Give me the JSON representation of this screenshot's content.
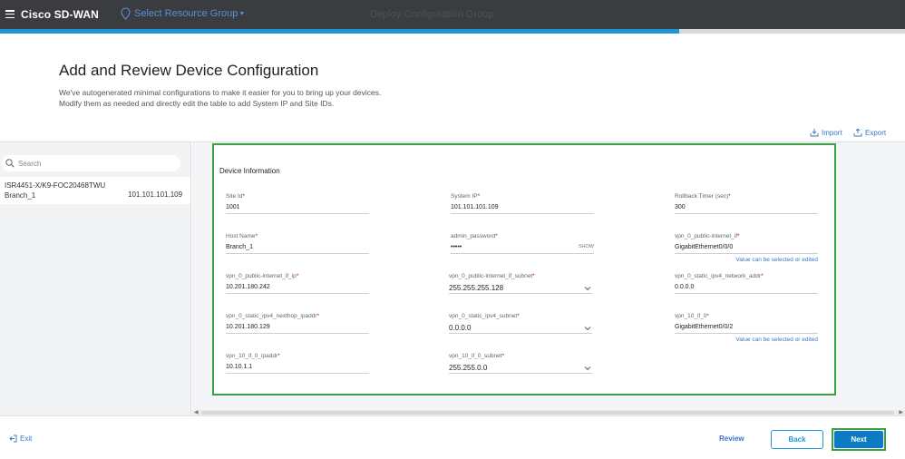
{
  "topbar": {
    "brand": "Cisco SD-WAN",
    "resource_group": "Select Resource Group",
    "center_title": "Deploy Configuration Group",
    "progress_percent": 75
  },
  "page": {
    "title": "Add and Review Device Configuration",
    "description_line1": "We've autogenerated minimal configurations to make it easier for you to bring up your devices.",
    "description_line2": "Modify them as needed and directly edit the table to add System IP and Site IDs.",
    "import_label": "Import",
    "export_label": "Export"
  },
  "sidebar": {
    "search_placeholder": "Search",
    "devices": [
      {
        "name": "ISR4451-X/K9-FOC20468TWU",
        "site": "Branch_1",
        "ip": "101.101.101.109"
      }
    ]
  },
  "form": {
    "section_title": "Device Information",
    "fields": [
      {
        "label": "Site Id",
        "required": "*",
        "value": "1001"
      },
      {
        "label": "System IP",
        "required": "*",
        "value": "101.101.101.109"
      },
      {
        "label": "Rollback Timer (sec)",
        "required": "*",
        "value": "300"
      },
      {
        "label": "Host Name",
        "required": "*",
        "value": "Branch_1"
      },
      {
        "label": "admin_password",
        "required": "*",
        "value": "•••••",
        "show": "SHOW"
      },
      {
        "label": "vpn_0_public-internet_if",
        "required": "*",
        "value": "GigabitEthernet0/0/0",
        "hint": "Value can be selected or edited"
      },
      {
        "label": "vpn_0_public-internet_if_ip",
        "required": "*",
        "value": "10.201.180.242"
      },
      {
        "label": "vpn_0_public-internet_if_subnet",
        "required": "*",
        "value": "255.255.255.128"
      },
      {
        "label": "vpn_0_static_ipv4_network_addr",
        "required": "*",
        "value": "0.0.0.0"
      },
      {
        "label": "vpn_0_static_ipv4_nexthop_ipaddr",
        "required": "*",
        "value": "10.201.180.129"
      },
      {
        "label": "vpn_0_static_ipv4_subnet",
        "required": "*",
        "value": "0.0.0.0"
      },
      {
        "label": "vpn_10_if_0",
        "required": "*",
        "value": "GigabitEthernet0/0/2",
        "hint": "Value can be selected or edited"
      },
      {
        "label": "vpn_10_if_0_ipaddr",
        "required": "*",
        "value": "10.10.1.1"
      },
      {
        "label": "vpn_10_if_0_subnet",
        "required": "*",
        "value": "255.255.0.0"
      }
    ]
  },
  "footer": {
    "exit_label": "Exit",
    "review_label": "Review",
    "back_label": "Back",
    "next_label": "Next"
  },
  "colors": {
    "topbar": "#3a3c3f",
    "accent": "#1e95d4",
    "highlight": "#3aa046",
    "link": "#3b75c4"
  }
}
